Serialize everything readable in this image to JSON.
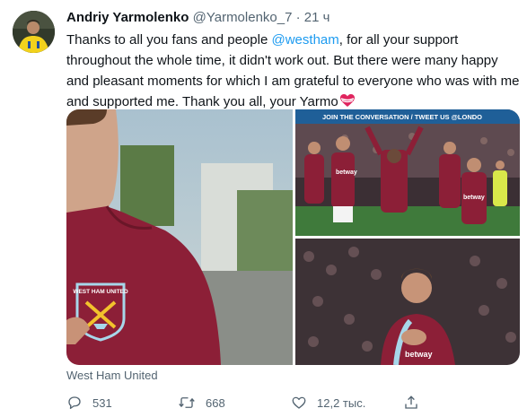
{
  "tweet": {
    "author_name": "Andriy Yarmolenko",
    "author_handle": "@Yarmolenko_7",
    "separator": "·",
    "time": "21 ч",
    "text_part1": "Thanks to all you fans and people ",
    "mention": "@westham",
    "text_part2": ", for all your support throughout the whole time, it didn't work out.  But there were many happy and pleasant moments for which I am grateful to everyone who was with me and supported me.  Thank you all, your Yarmo",
    "media_caption": "West Ham United",
    "photo_banner_text": "JOIN THE CONVERSATION / TWEET US @LONDO",
    "sponsor": "betway",
    "crest_text": "WEST HAM UNITED"
  },
  "actions": {
    "replies": "531",
    "retweets": "668",
    "likes": "12,2 тыс."
  },
  "colors": {
    "accent": "#1d9bf0",
    "text_secondary": "#536471",
    "claret": "#7a263a",
    "heart_red": "#e0245e"
  }
}
